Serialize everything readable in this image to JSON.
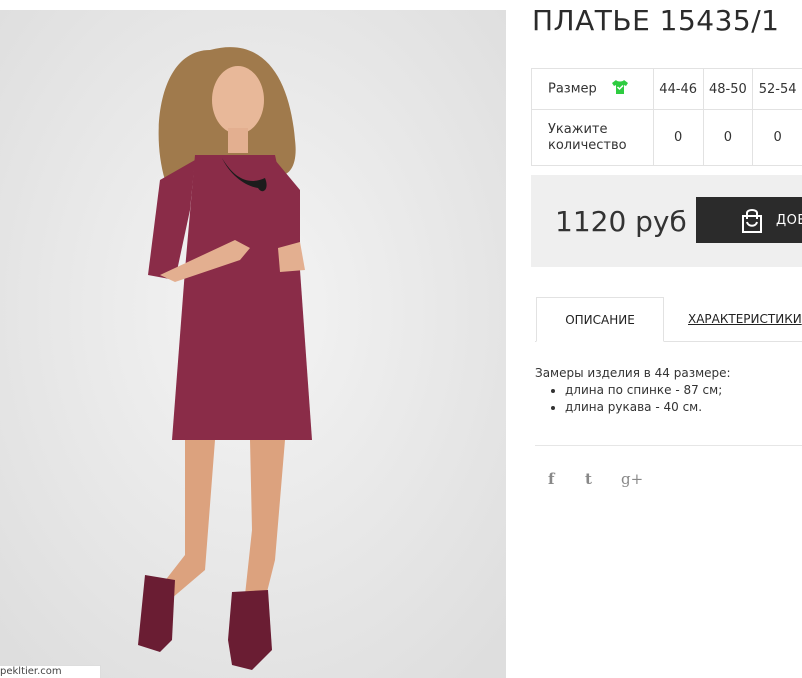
{
  "product": {
    "title": "ПЛАТЬЕ 15435/1",
    "watermark": "pekltier.com"
  },
  "sizes": {
    "header_label": "Размер",
    "quantity_label": "Укажите количество",
    "columns": [
      {
        "size": "44-46",
        "quantity": "0"
      },
      {
        "size": "48-50",
        "quantity": "0"
      },
      {
        "size": "52-54",
        "quantity": "0"
      }
    ]
  },
  "price": {
    "value": "1120 руб",
    "cart_button_label": "ДОБ"
  },
  "tabs": [
    {
      "label": "ОПИСАНИЕ",
      "active": true
    },
    {
      "label": "ХАРАКТЕРИСТИКИ",
      "active": false
    }
  ],
  "description": {
    "intro": "Замеры изделия в 44 размере:",
    "items": [
      "длина по спинке - 87 см;",
      "длина рукава - 40 см."
    ]
  },
  "social": {
    "facebook": "f",
    "twitter": "t",
    "googleplus": "g+"
  },
  "icons": {
    "shirt": "shirt-icon",
    "cart": "shopping-bag-icon",
    "facebook": "facebook-icon",
    "twitter": "twitter-icon",
    "googleplus": "googleplus-icon"
  },
  "colors": {
    "dress": "#8a2c48",
    "button_bg": "#2b2b2b",
    "price_bg": "#efefef",
    "shirt_icon": "#2ecc40"
  }
}
